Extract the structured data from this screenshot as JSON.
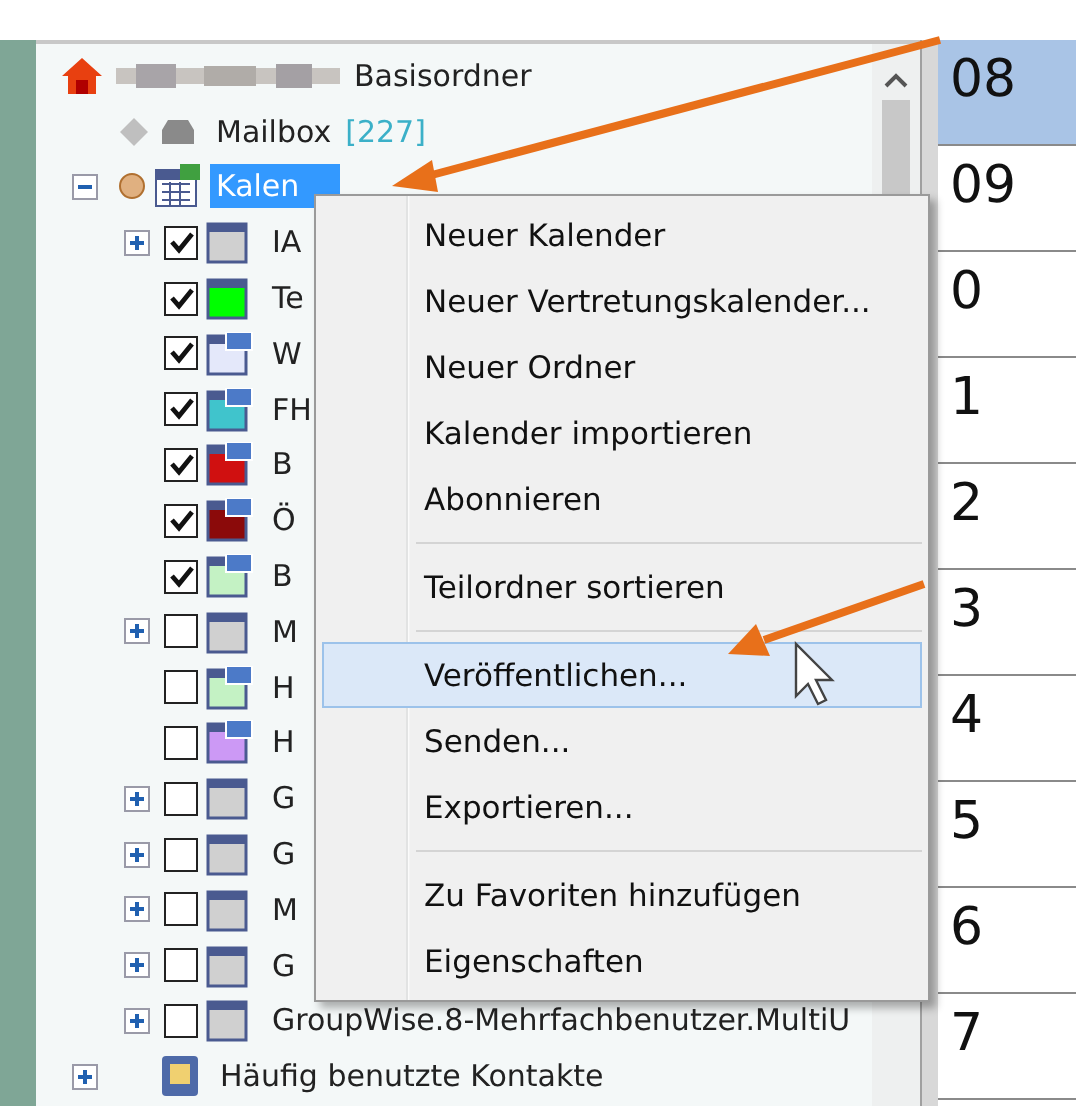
{
  "tree": {
    "label": "Basisordner",
    "children": [
      {
        "label": "Mailbox",
        "count": "[227]"
      },
      {
        "label": "Kalen",
        "expanded": true,
        "selected": true,
        "children": [
          {
            "label": "IA",
            "kind": "plain",
            "checked": true,
            "color": "#d0d0d0",
            "expanded": false
          },
          {
            "label": "Te",
            "kind": "plain",
            "checked": true,
            "color": "#00ff00"
          },
          {
            "label": "W",
            "kind": "shared",
            "checked": true,
            "color": "#e4e8fa"
          },
          {
            "label": "FH",
            "kind": "shared",
            "checked": true,
            "color": "#40c4cc"
          },
          {
            "label": "B",
            "kind": "shared",
            "checked": true,
            "color": "#d01010"
          },
          {
            "label": "Ö",
            "kind": "shared",
            "checked": true,
            "color": "#8b0a0a"
          },
          {
            "label": "B",
            "kind": "shared",
            "checked": true,
            "color": "#c4f2c4"
          },
          {
            "label": "M",
            "kind": "plain",
            "checked": false,
            "color": "#d0d0d0",
            "expanded": false
          },
          {
            "label": "H",
            "kind": "shared",
            "checked": false,
            "color": "#c4f2c4"
          },
          {
            "label": "H",
            "kind": "shared",
            "checked": false,
            "color": "#cc99f5"
          },
          {
            "label": "G",
            "kind": "plain",
            "checked": false,
            "color": "#d0d0d0",
            "expanded": false
          },
          {
            "label": "G",
            "kind": "plain",
            "checked": false,
            "color": "#d0d0d0",
            "expanded": false
          },
          {
            "label": "M",
            "kind": "plain",
            "checked": false,
            "color": "#d0d0d0",
            "expanded": false
          },
          {
            "label": "G",
            "kind": "plain",
            "checked": false,
            "color": "#d0d0d0",
            "expanded": false
          },
          {
            "label": "GroupWise.8-Mehrfachbenutzer.MultiU",
            "kind": "plain",
            "checked": false,
            "color": "#d0d0d0",
            "expanded": false
          }
        ]
      },
      {
        "label": "Häufig benutzte Kontakte",
        "expanded": false
      }
    ]
  },
  "hours": [
    {
      "label": "08",
      "selected": true
    },
    {
      "label": "09",
      "selected": false
    },
    {
      "label": "0",
      "selected": false
    },
    {
      "label": "1",
      "selected": false
    },
    {
      "label": "2",
      "selected": false
    },
    {
      "label": "3",
      "selected": false
    },
    {
      "label": "4",
      "selected": false
    },
    {
      "label": "5",
      "selected": false
    },
    {
      "label": "6",
      "selected": false
    },
    {
      "label": "7",
      "selected": false
    }
  ],
  "context_menu": [
    {
      "kind": "item",
      "label": "Neuer Kalender",
      "selected": false
    },
    {
      "kind": "item",
      "label": "Neuer Vertretungskalender...",
      "selected": false
    },
    {
      "kind": "item",
      "label": "Neuer Ordner",
      "selected": false
    },
    {
      "kind": "item",
      "label": "Kalender importieren",
      "selected": false
    },
    {
      "kind": "item",
      "label": "Abonnieren",
      "selected": false
    },
    {
      "kind": "separator"
    },
    {
      "kind": "item",
      "label": "Teilordner sortieren",
      "selected": false
    },
    {
      "kind": "separator"
    },
    {
      "kind": "item",
      "label": "Veröffentlichen...",
      "selected": true
    },
    {
      "kind": "item",
      "label": "Senden...",
      "selected": false
    },
    {
      "kind": "item",
      "label": "Exportieren...",
      "selected": false
    },
    {
      "kind": "separator"
    },
    {
      "kind": "item",
      "label": "Zu Favoriten hinzufügen",
      "selected": false
    },
    {
      "kind": "item",
      "label": "Eigenschaften",
      "selected": false
    }
  ]
}
